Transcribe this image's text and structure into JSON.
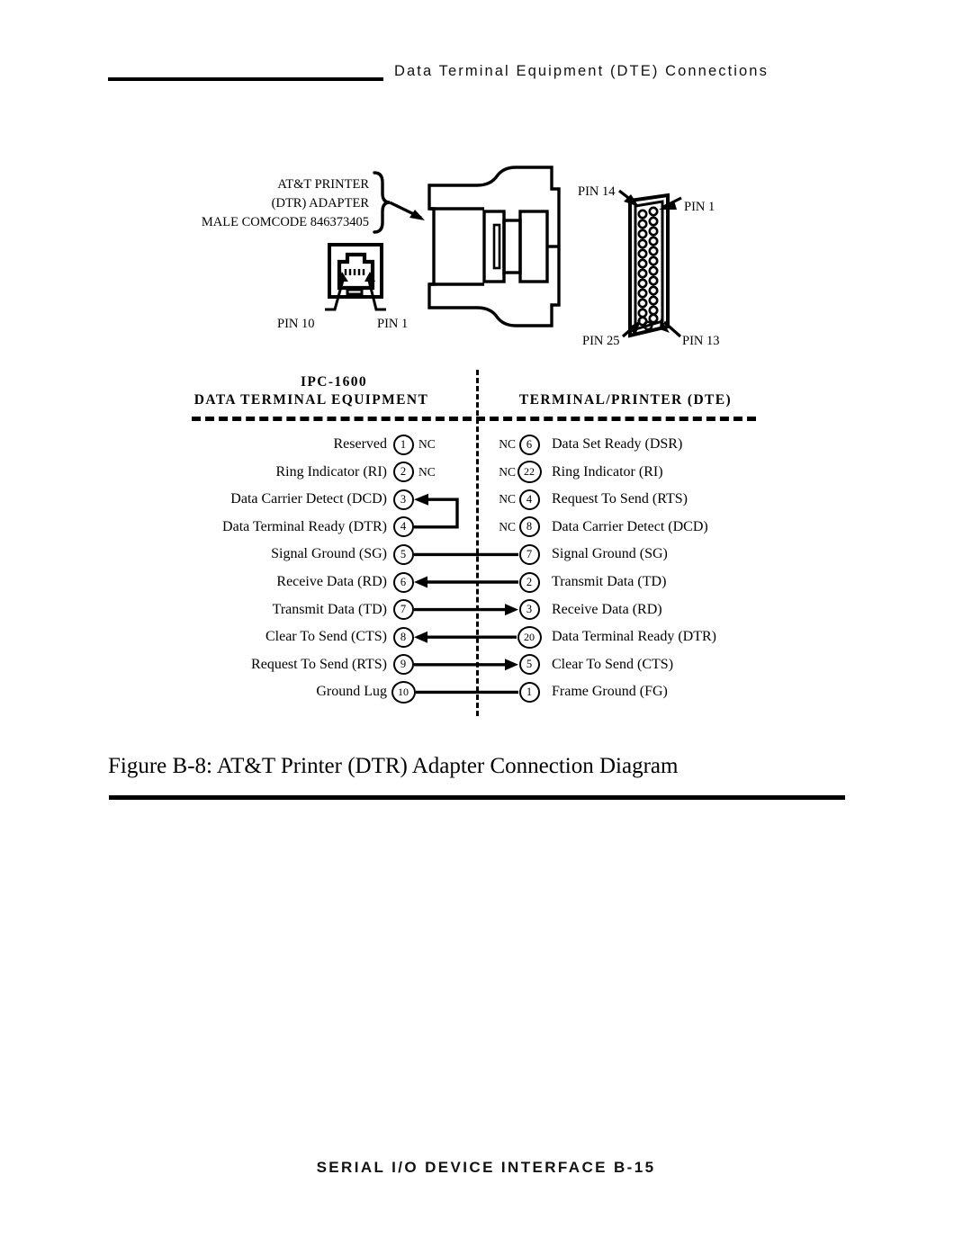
{
  "running_head": {
    "title": "Data Terminal Equipment (DTE) Connections"
  },
  "figure": {
    "caption": "Figure B-8:  AT&T Printer (DTR) Adapter Connection Diagram",
    "artwork": {
      "adapter_label": {
        "line1": "AT&T  PRINTER",
        "line2": "(DTR)  ADAPTER",
        "line3": "MALE COMCODE 846373405"
      },
      "modular_jack_pins": {
        "left": "PIN 10",
        "right": "PIN 1"
      },
      "db25_pins": {
        "top_left": "PIN 14",
        "top_right": "PIN 1",
        "bottom_left": "PIN 25",
        "bottom_right": "PIN 13"
      }
    }
  },
  "pinout": {
    "header": {
      "left_line1": "IPC-1600",
      "left_line2": "DATA  TERMINAL  EQUIPMENT",
      "right": "TERMINAL/PRINTER  (DTE)"
    },
    "rows": [
      {
        "left_label": "Reserved",
        "left_pin": "1",
        "left_nc": "NC",
        "right_nc": "NC",
        "right_pin": "6",
        "right_label": "Data Set Ready (DSR)",
        "connection": "none"
      },
      {
        "left_label": "Ring Indicator (RI)",
        "left_pin": "2",
        "left_nc": "NC",
        "right_nc": "NC",
        "right_pin": "22",
        "right_label": "Ring Indicator (RI)",
        "connection": "none"
      },
      {
        "left_label": "Data Carrier Detect (DCD)",
        "left_pin": "3",
        "left_nc": "",
        "right_nc": "NC",
        "right_pin": "4",
        "right_label": "Request To Send  (RTS)",
        "connection": "loopback-in"
      },
      {
        "left_label": "Data Terminal Ready (DTR)",
        "left_pin": "4",
        "left_nc": "",
        "right_nc": "NC",
        "right_pin": "8",
        "right_label": "Data Carrier Detect (DCD)",
        "connection": "loopback-out"
      },
      {
        "left_label": "Signal  Ground  (SG)",
        "left_pin": "5",
        "left_nc": "",
        "right_nc": "",
        "right_pin": "7",
        "right_label": "Signal  Ground  (SG)",
        "connection": "plain"
      },
      {
        "left_label": "Receive Data (RD)",
        "left_pin": "6",
        "left_nc": "",
        "right_nc": "",
        "right_pin": "2",
        "right_label": "Transmit Data (TD)",
        "connection": "arrow-left"
      },
      {
        "left_label": "Transmit Data (TD)",
        "left_pin": "7",
        "left_nc": "",
        "right_nc": "",
        "right_pin": "3",
        "right_label": "Receive Data (RD)",
        "connection": "arrow-right"
      },
      {
        "left_label": "Clear To Send  (CTS)",
        "left_pin": "8",
        "left_nc": "",
        "right_nc": "",
        "right_pin": "20",
        "right_label": "Data Terminal Ready (DTR)",
        "connection": "arrow-left"
      },
      {
        "left_label": "Request To Send  (RTS)",
        "left_pin": "9",
        "left_nc": "",
        "right_nc": "",
        "right_pin": "5",
        "right_label": "Clear To Send  (CTS)",
        "connection": "arrow-right"
      },
      {
        "left_label": "Ground Lug",
        "left_pin": "10",
        "left_nc": "",
        "right_nc": "",
        "right_pin": "1",
        "right_label": "Frame Ground (FG)",
        "connection": "plain"
      }
    ]
  },
  "footer": {
    "text": "SERIAL I/O DEVICE INTERFACE   B-15"
  }
}
